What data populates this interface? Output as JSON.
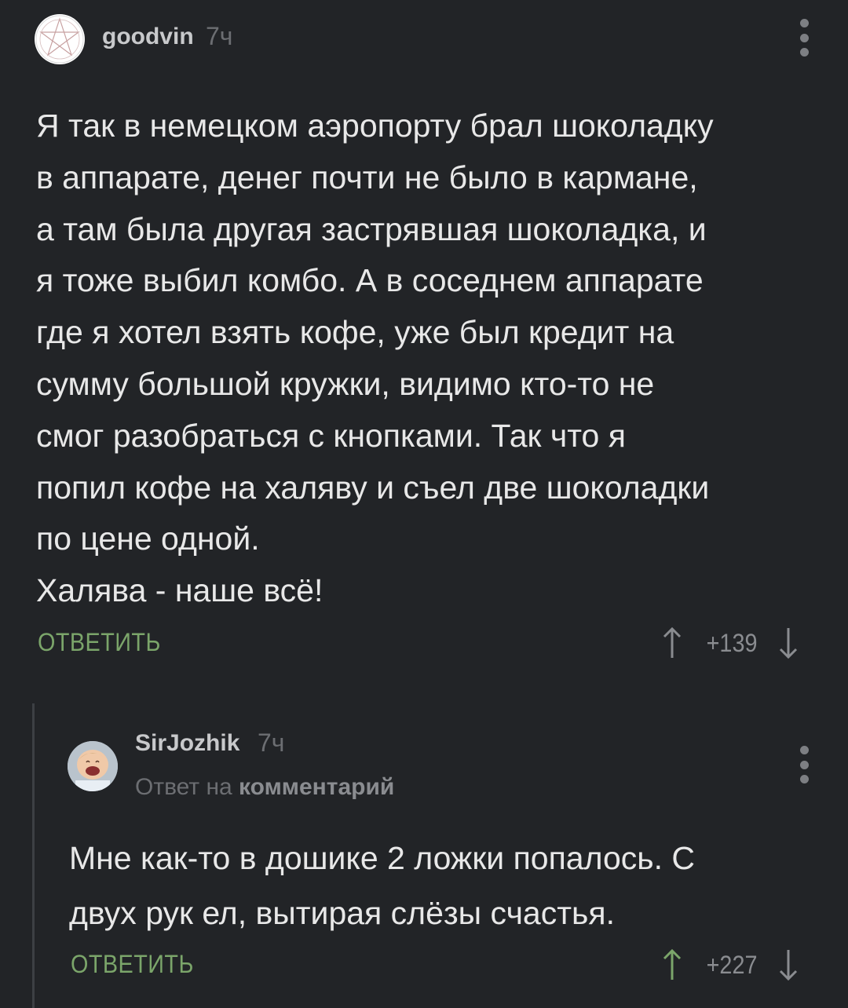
{
  "comments": [
    {
      "username": "goodvin",
      "time": "7ч",
      "body_lines": [
        "Я так в немецком аэропорту брал шоколадку",
        "в аппарате, денег почти не было в кармане,",
        "а там была другая застрявшая шоколадка, и",
        "я тоже выбил комбо. А в соседнем аппарате",
        "где я хотел взять кофе, уже был кредит на",
        "сумму большой кружки, видимо кто-то не",
        "смог разобраться с кнопками. Так что я",
        "попил кофе на халяву и съел две шоколадки",
        "по цене одной.",
        "Халява - наше всё!"
      ],
      "reply_label": "ОТВЕТИТЬ",
      "score": "+139",
      "upvoted": false
    },
    {
      "username": "SirJozhik",
      "time": "7ч",
      "reply_to_prefix": "Ответ на",
      "reply_to_link": "комментарий",
      "body_lines": [
        "Мне как-то в дошике 2 ложки попалось. С",
        "двух рук ел, вытирая слёзы счастья."
      ],
      "reply_label": "ОТВЕТИТЬ",
      "score": "+227",
      "upvoted": true
    }
  ],
  "colors": {
    "background": "#222427",
    "reply_label": "#7ba56a",
    "upvote_active": "#7ba56a",
    "arrow_inactive": "#8a8c90"
  },
  "icons": [
    "pentagram-avatar-icon",
    "baby-photo-avatar-icon",
    "more-vertical-icon",
    "arrow-up-icon",
    "arrow-down-icon"
  ]
}
